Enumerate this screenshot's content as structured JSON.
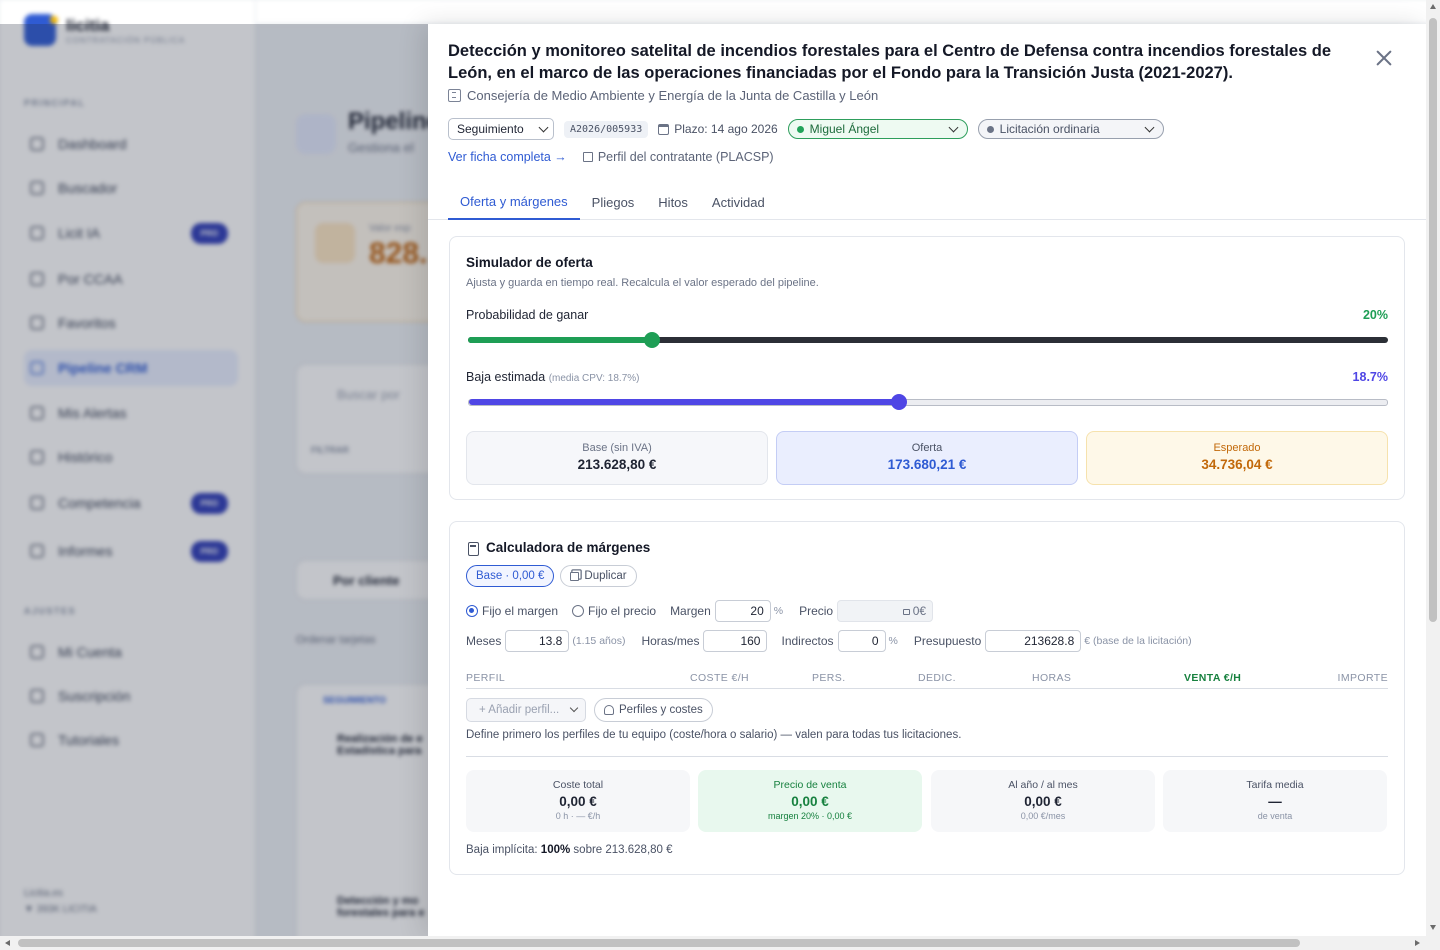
{
  "colors": {
    "accent": "#2f5bd3",
    "prob": "#1e9e55",
    "baja": "#4f46e5",
    "expected": "#c2690a",
    "green_text": "#17813f"
  },
  "background": {
    "brand": "licitia",
    "brand_sub": "CONTRATACIÓN PÚBLICA",
    "sections": {
      "principal": "PRINCIPAL",
      "ajustes": "AJUSTES"
    },
    "nav": [
      {
        "label": "Dashboard",
        "icon": "grid-icon"
      },
      {
        "label": "Buscador",
        "icon": "search-icon"
      },
      {
        "label": "Licit IA",
        "icon": "sparkle-icon",
        "badge": "PRO"
      },
      {
        "label": "Por CCAA",
        "icon": "globe-icon"
      },
      {
        "label": "Favoritos",
        "icon": "heart-icon"
      },
      {
        "label": "Pipeline CRM",
        "icon": "briefcase-icon",
        "active": true
      },
      {
        "label": "Mis Alertas",
        "icon": "bell-icon"
      },
      {
        "label": "Histórico",
        "icon": "archive-icon"
      },
      {
        "label": "Competencia",
        "icon": "target-icon",
        "badge": "PRO"
      },
      {
        "label": "Informes",
        "icon": "chart-icon",
        "badge": "PRO"
      }
    ],
    "settings_nav": [
      {
        "label": "Mi Cuenta",
        "icon": "user-icon"
      },
      {
        "label": "Suscripción",
        "icon": "card-icon"
      },
      {
        "label": "Tutoriales",
        "icon": "book-icon"
      }
    ],
    "footer": {
      "line1": "Licitia.es",
      "line2": "▼ 393K LICITIA"
    },
    "main": {
      "title": "Pipeline",
      "title_sub": "Gestiona el",
      "card_label": "Valor esp",
      "card_value": "828.",
      "card_note1": "Cobertura",
      "card_note2": "ponderada",
      "search_placeholder": "Buscar por",
      "filter_label": "FILTRAR",
      "filter_value": "Cliente",
      "views_label": "VISTAS",
      "views_value": "+ Gua",
      "group_label": "Por cliente",
      "order_label": "Ordenar tarjetas",
      "col_label": "SEGUIMIENTO",
      "item1": "Realización de e Estadística para",
      "item1_org": "Consejería de Eco",
      "item2": "Detección y mo forestales para e",
      "item2_org": "Consejería de Me"
    }
  },
  "drawer": {
    "title": "Detección y monitoreo satelital de incendios forestales para el Centro de Defensa contra incendios forestales de León, en el marco de las operaciones financiadas por el Fondo para la Transición Justa (2021-2027).",
    "organization": "Consejería de Medio Ambiente y Energía de la Junta de Castilla y León",
    "status": "Seguimiento",
    "code": "A2026/005933",
    "deadline": "Plazo: 14 ago 2026",
    "assignee": "Miguel Ángel",
    "procedure": "Licitación ordinaria",
    "full_record_link": "Ver ficha completa →",
    "contractor_link": "Perfil del contratante (PLACSP)",
    "tabs": [
      "Oferta y márgenes",
      "Pliegos",
      "Hitos",
      "Actividad"
    ],
    "active_tab": 0
  },
  "simulator": {
    "title": "Simulador de oferta",
    "subtitle": "Ajusta y guarda en tiempo real. Recalcula el valor esperado del pipeline.",
    "prob_label": "Probabilidad de ganar",
    "prob_value": 20,
    "prob_display": "20%",
    "baja_label": "Baja estimada",
    "baja_hint": "(media CPV: 18.7%)",
    "baja_value": 18.7,
    "baja_max": 40,
    "baja_display": "18.7%",
    "base_label": "Base (sin IVA)",
    "base_value": "213.628,80 €",
    "offer_label": "Oferta",
    "offer_value": "173.680,21 €",
    "expected_label": "Esperado",
    "expected_value": "34.736,04 €"
  },
  "margins": {
    "title": "Calculadora de márgenes",
    "chip_base": "Base · 0,00 €",
    "chip_duplicate": "Duplicar",
    "radio_margin": "Fijo el margen",
    "radio_price": "Fijo el precio",
    "margin_label": "Margen",
    "margin_value": "20",
    "price_label": "Precio",
    "price_value": "0€",
    "months_label": "Meses",
    "months_value": "13.8",
    "months_years": "(1.15 años)",
    "hours_label": "Horas/mes",
    "hours_value": "160",
    "indirect_label": "Indirectos",
    "indirect_value": "0",
    "budget_label": "Presupuesto",
    "budget_value": "213628.8",
    "budget_unit": "€ (base de la licitación)",
    "pct": "%",
    "columns": [
      "PERFIL",
      "COSTE €/H",
      "PERS.",
      "DEDIC.",
      "HORAS",
      "VENTA €/H",
      "IMPORTE"
    ],
    "add_profile": "+ Añadir perfil...",
    "profiles_button": "Perfiles y costes",
    "hint": "Define primero los perfiles de tu equipo (coste/hora o salario) — valen para todas tus licitaciones.",
    "summary": [
      {
        "label": "Coste total",
        "value": "0,00 €",
        "sub": "0 h · — €/h"
      },
      {
        "label": "Precio de venta",
        "value": "0,00 €",
        "sub": "margen 20% · 0,00 €"
      },
      {
        "label": "Al año / al mes",
        "value": "0,00 €",
        "sub": "0,00 €/mes"
      },
      {
        "label": "Tarifa media",
        "value": "—",
        "sub": "de venta"
      }
    ],
    "baja_prefix": "Baja implícita:",
    "baja_value": "100%",
    "baja_suffix": "sobre 213.628,80 €"
  }
}
